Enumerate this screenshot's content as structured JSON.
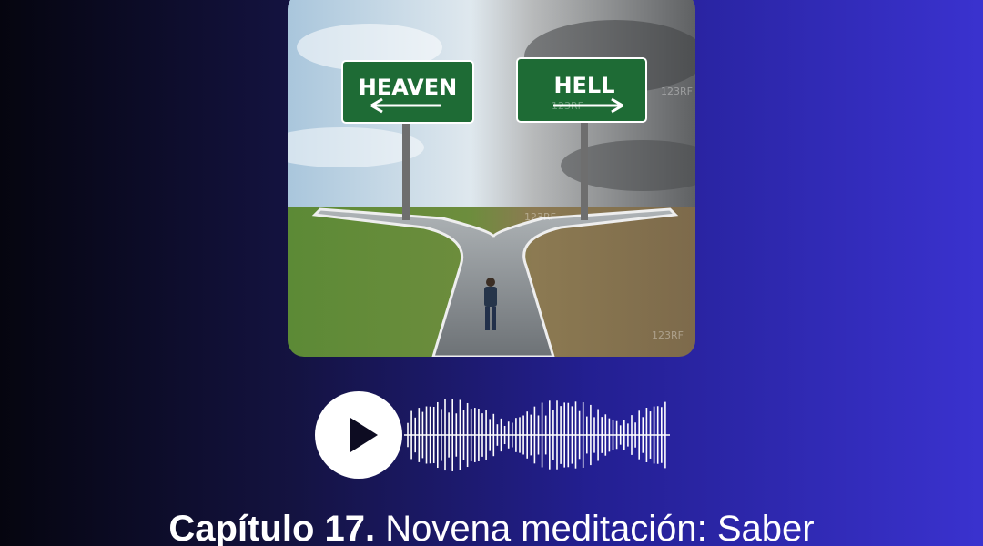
{
  "cover": {
    "sign_left": "HEAVEN",
    "sign_right": "HELL",
    "watermark": "123RF"
  },
  "player": {
    "play_icon": "play-icon",
    "waveform_icon": "audio-waveform-icon"
  },
  "episode": {
    "chapter": "Capítulo 17.",
    "title": "Novena meditación: Saber"
  },
  "colors": {
    "sign_green": "#1e6b35",
    "accent_blue": "#3a32cf",
    "dark": "#05050f"
  }
}
